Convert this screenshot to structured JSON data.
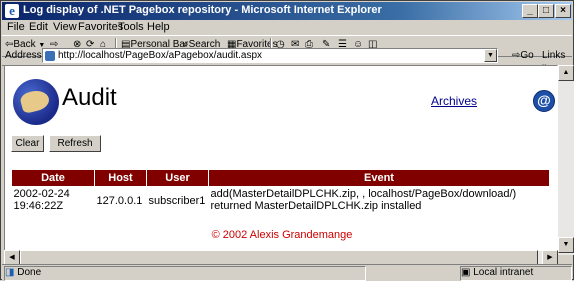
{
  "window": {
    "title": "Log display of .NET Pagebox repository - Microsoft Internet Explorer",
    "minimize": "_",
    "maximize": "□",
    "close": "×"
  },
  "menu": [
    "File",
    "Edit",
    "View",
    "Favorites",
    "Tools",
    "Help"
  ],
  "toolbar": {
    "back": "Back",
    "personal_bar": "Personal Bar",
    "search": "Search",
    "favorites": "Favorites"
  },
  "address": {
    "label": "Address",
    "url": "http://localhost/PageBox/aPagebox/audit.aspx",
    "go": "Go",
    "links": "Links"
  },
  "page": {
    "title": "Audit",
    "archives": "Archives",
    "clear": "Clear",
    "refresh": "Refresh",
    "table": {
      "headers": [
        "Date",
        "Host",
        "User",
        "Event"
      ],
      "rows": [
        {
          "date": "2002-02-24 19:46:22Z",
          "host": "127.0.0.1",
          "user": "subscriber1",
          "event": "add(MasterDetailDPLCHK.zip, , localhost/PageBox/download/) returned MasterDetailDPLCHK.zip installed"
        }
      ]
    },
    "footer": "© 2002 Alexis Grandemange"
  },
  "status": {
    "text": "Done",
    "zone": "Local intranet"
  },
  "colors": {
    "header_bg": "#800000",
    "footer_text": "#cc0000",
    "link": "#00008b"
  }
}
